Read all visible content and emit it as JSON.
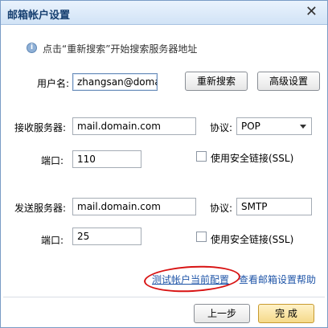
{
  "window": {
    "title": "邮箱帐户设置",
    "close_icon": "close-icon"
  },
  "hint": {
    "icon": "info-icon",
    "text": "点击“重新搜索”开始搜索服务器地址"
  },
  "username": {
    "label": "用户名:",
    "value": "zhangsan@domain"
  },
  "buttons": {
    "research": "重新搜索",
    "advanced": "高级设置",
    "prev": "上一步",
    "finish": "完 成"
  },
  "incoming": {
    "server_label": "接收服务器:",
    "server_value": "mail.domain.com",
    "protocol_label": "协议:",
    "protocol_value": "POP",
    "port_label": "端口:",
    "port_value": "110",
    "ssl_label": "使用安全链接(SSL)"
  },
  "outgoing": {
    "server_label": "发送服务器:",
    "server_value": "mail.domain.com",
    "protocol_label": "协议:",
    "protocol_value": "SMTP",
    "port_label": "端口:",
    "port_value": "25",
    "ssl_label": "使用安全链接(SSL)"
  },
  "links": {
    "test": "测试帐户当前配置",
    "help": "查看邮箱设置帮助"
  },
  "colors": {
    "title": "#163f70",
    "link": "#1f55a8",
    "highlight_circle": "#d81212"
  }
}
